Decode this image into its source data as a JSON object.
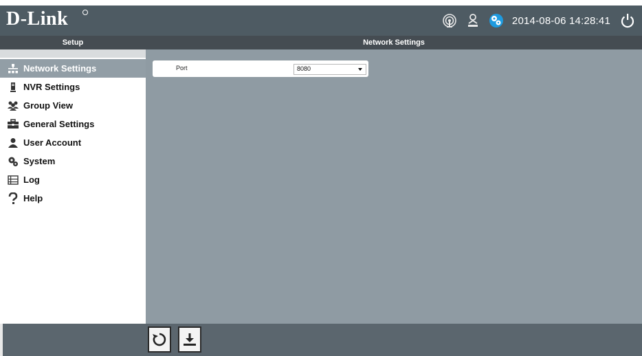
{
  "header": {
    "logo_text": "D-Link",
    "datetime": "2014-08-06 14:28:41",
    "icons": [
      "network-status-icon",
      "user-location-icon",
      "settings-gear-icon",
      "power-icon"
    ],
    "accent_color": "#1e9be0",
    "bg_color": "#4e5b63"
  },
  "titlebar": {
    "left_label": "Setup",
    "right_label": "Network Settings"
  },
  "sidebar": {
    "items": [
      {
        "label": "Network Settings",
        "icon": "network-icon",
        "active": true
      },
      {
        "label": "NVR Settings",
        "icon": "nvr-icon",
        "active": false
      },
      {
        "label": "Group View",
        "icon": "group-icon",
        "active": false
      },
      {
        "label": "General Settings",
        "icon": "toolbox-icon",
        "active": false
      },
      {
        "label": "User Account",
        "icon": "user-icon",
        "active": false
      },
      {
        "label": "System",
        "icon": "system-gear-icon",
        "active": false
      },
      {
        "label": "Log",
        "icon": "log-icon",
        "active": false
      },
      {
        "label": "Help",
        "icon": "help-icon",
        "active": false
      }
    ]
  },
  "form": {
    "port_label": "Port",
    "port_value": "8080"
  },
  "footer": {
    "buttons": [
      "refresh-button",
      "save-button"
    ]
  }
}
